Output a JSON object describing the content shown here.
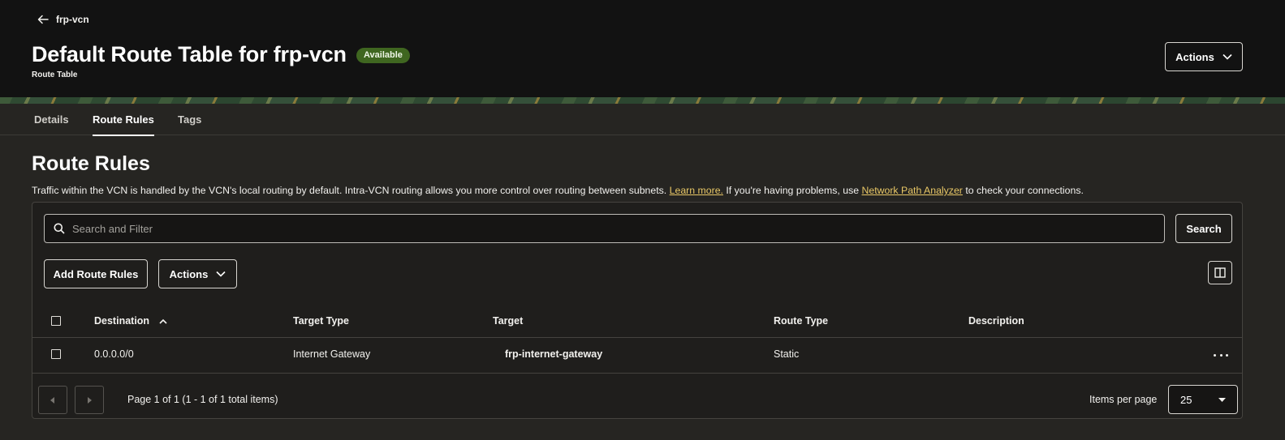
{
  "header": {
    "back_label": "frp-vcn",
    "title": "Default Route Table for frp-vcn",
    "status": "Available",
    "subtitle": "Route Table",
    "actions_label": "Actions"
  },
  "tabs": [
    {
      "label": "Details",
      "active": false
    },
    {
      "label": "Route Rules",
      "active": true
    },
    {
      "label": "Tags",
      "active": false
    }
  ],
  "section": {
    "title": "Route Rules",
    "desc_part1": "Traffic within the VCN is handled by the VCN's local routing by default. Intra-VCN routing allows you more control over routing between subnets.",
    "learn_more": "Learn more.",
    "desc_part2": "If you're having problems, use",
    "analyzer_link": "Network Path Analyzer",
    "desc_part3": "to check your connections."
  },
  "search": {
    "placeholder": "Search and Filter",
    "button_label": "Search"
  },
  "toolbar": {
    "add_label": "Add Route Rules",
    "actions_label": "Actions"
  },
  "table": {
    "columns": [
      "Destination",
      "Target Type",
      "Target",
      "Route Type",
      "Description"
    ],
    "rows": [
      {
        "destination": "0.0.0.0/0",
        "target_type": "Internet Gateway",
        "target": "frp-internet-gateway",
        "route_type": "Static",
        "description": ""
      }
    ]
  },
  "pagination": {
    "summary": "Page 1 of 1 (1 - 1 of 1 total items)",
    "per_page_label": "Items per page",
    "per_page_value": "25"
  }
}
